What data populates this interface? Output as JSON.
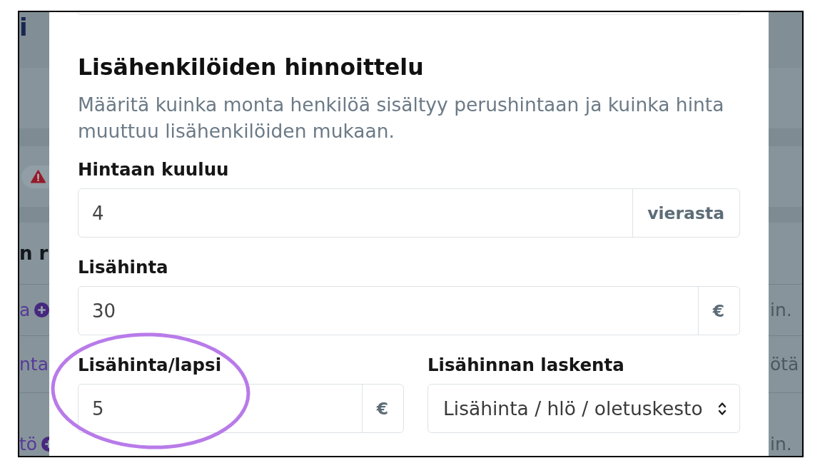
{
  "background": {
    "left": {
      "title_fragment": "i",
      "heading_fragment": "n r",
      "rows": [
        {
          "text": "a",
          "kind": "add"
        },
        {
          "text": "nta",
          "kind": "text"
        },
        {
          "text": "tö",
          "kind": "add"
        }
      ]
    },
    "right": {
      "rows": [
        {
          "text": "in."
        },
        {
          "text": "ötä"
        },
        {
          "text": "in."
        }
      ]
    }
  },
  "dialog": {
    "title": "Lisähenkilöiden hinnoittelu",
    "description": "Määritä kuinka monta henkilöä sisältyy perushintaan ja kuinka hinta muuttuu lisähenkilöiden mukaan.",
    "rows": [
      [
        {
          "kind": "input",
          "label": "Hintaan kuuluu",
          "value": "4",
          "unit": "vierasta",
          "highlighted": false
        }
      ],
      [
        {
          "kind": "input",
          "label": "Lisähinta",
          "value": "30",
          "unit": "€",
          "highlighted": false
        }
      ],
      [
        {
          "kind": "input",
          "label": "Lisähinta/lapsi",
          "value": "5",
          "unit": "€",
          "highlighted": true
        },
        {
          "kind": "select",
          "label": "Lisähinnan laskenta",
          "value": "Lisähinta / hlö / oletuskesto",
          "highlighted": false
        }
      ]
    ]
  }
}
